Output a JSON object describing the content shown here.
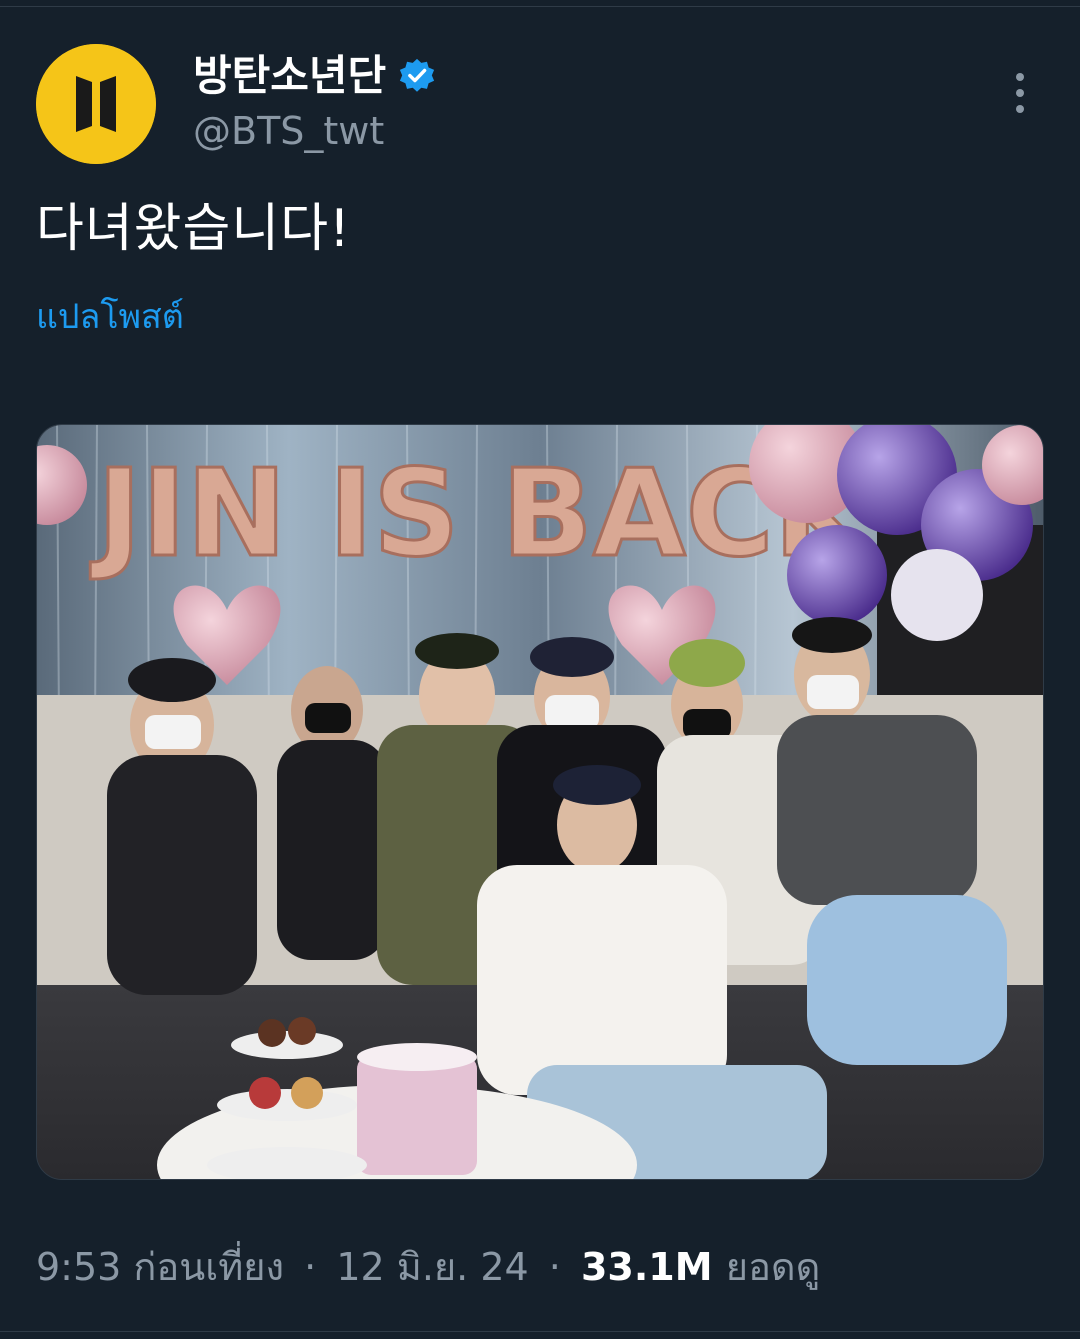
{
  "author": {
    "display_name": "방탄소년단",
    "handle": "@BTS_twt",
    "verified": true,
    "avatar_icon": "bts-logo-icon",
    "avatar_color": "#f5c518"
  },
  "tweet": {
    "text": "다녀왔습니다!",
    "translate_label": "แปลโพสต์"
  },
  "media": {
    "image_icon": "photo",
    "banner_letters": "JIN IS BACK"
  },
  "meta": {
    "time": "9:53 ก่อนเที่ยง",
    "separator": "·",
    "date": "12 มิ.ย. 24",
    "views_count": "33.1M",
    "views_label": "ยอดดู"
  },
  "colors": {
    "background": "#15202b",
    "link": "#1d9bf0",
    "secondary_text": "#8b98a5",
    "verified_badge": "#1d9bf0"
  }
}
